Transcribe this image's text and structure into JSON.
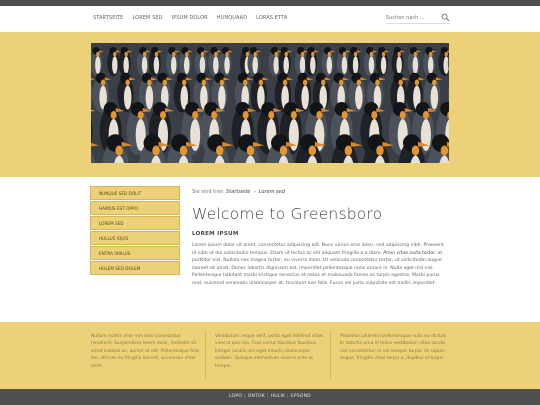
{
  "nav": {
    "items": [
      "Startseite",
      "Lorem sed",
      "Ipsum dolor",
      "Hunquaad",
      "Loras etta"
    ]
  },
  "search": {
    "placeholder": "Suchen nach ..."
  },
  "sidebar": {
    "items": [
      "Nunque sed dolit",
      "Hamius est oppo",
      "Lorem sed",
      "Hullus iquis",
      "Entra vibilus",
      "Holem sed dolem"
    ]
  },
  "breadcrumb": {
    "prefix": "Sie sind hier:",
    "home": "Startseite",
    "separator": "»",
    "current": "Lorem sed"
  },
  "main": {
    "title": "Welcome to Greensboro",
    "subhead": "Lorem ipsum",
    "text_before": "Lorem ipsum dolor sit amet, consectetur adipiscing elit. Nunc varius eros dolor, sed adipiscing nibh. Praesent id nibh ut dui sollicitudin tempus. Etiam ut lectus ac elit aliquam fringilla a a diam.",
    "text_em": "Proin vitae nulla tortor,",
    "text_after": "at porttitor nisl. Nullam nec magna tortor, eu viverra diam. Ut vehicula consectetur tortor, ut sollicitudin augue laoreet sit amet. Donec lobortis dignissim est, imperdiet pellentesque nunc ornare in. Nulla eget nisl nisl. Pellentesque habitant morbi tristique senectus et netus et malesuada fames ac turpis egestas. Morbi purus erat, euismod venenatis ullamcorper at, tincidunt non felis. Fusce vel justo vulputate est mollis imperdiet."
  },
  "footer": {
    "col1": "Nullam mattis ante non odio consectetur hendrerit. Suspendisse lorem dolor, molestie sit amet sodales ac, auctor et elit. Pellentesque felis leo, ultrices eu fringilla laoreet, accumsan vitae enim",
    "col2": "Vestibulum neque velit, porta eget eleifend vitae, viverra quis leo. Cras varius faucibus faucibus. Integer iaculis nisl eget mauris ullamcorper sodales. Quisque elementum viverra ante ac tempor.",
    "col3": "Phasellus pharetra pellentesque nulla eu dictum. In lobortis urna id tellus vestibulum vitae iaculis nisl consectetur. In vel semper turpis. Ut sapien augue, fringilla vitae turpis a, dapibus id turpis."
  },
  "bottom": {
    "links": [
      "Lopo",
      "Ontok",
      "Hulik",
      "Epsond"
    ]
  },
  "colors": {
    "accent": "#ecd179",
    "dark_bar": "#4f4f4f"
  },
  "icons": {
    "search": "search-icon",
    "hero": "penguin-colony-photo"
  }
}
